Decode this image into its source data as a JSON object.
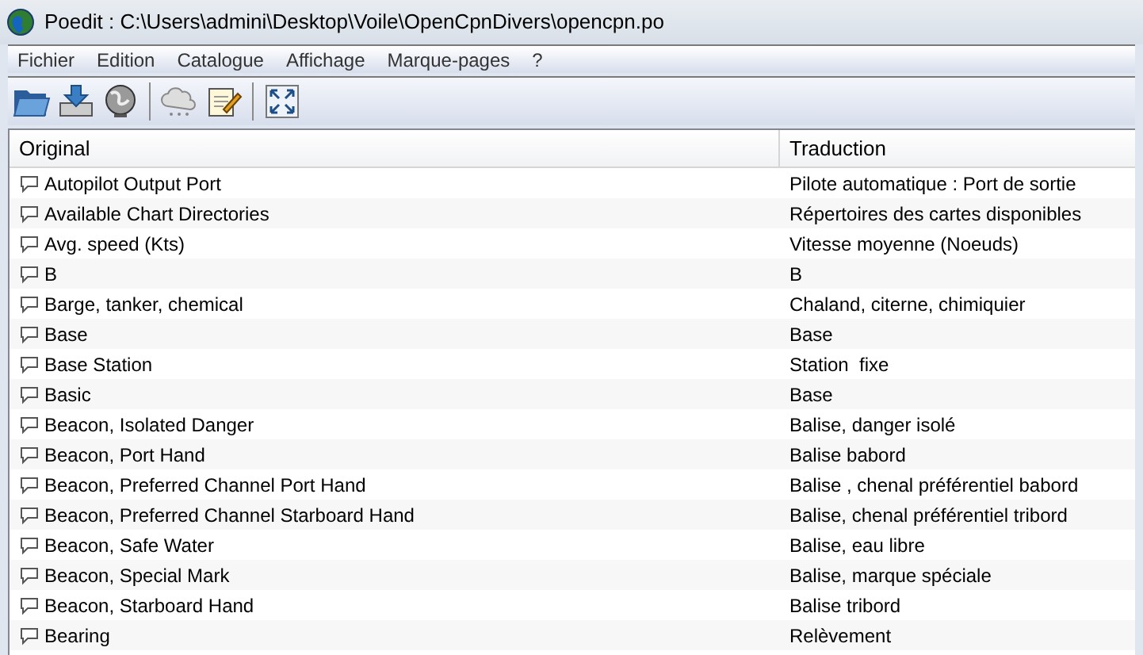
{
  "window": {
    "title": "Poedit : C:\\Users\\admini\\Desktop\\Voile\\OpenCpnDivers\\opencpn.po"
  },
  "menu": [
    "Fichier",
    "Edition",
    "Catalogue",
    "Affichage",
    "Marque-pages",
    "?"
  ],
  "table": {
    "columns": [
      "Original",
      "Traduction"
    ],
    "rows": [
      {
        "original": "Autopilot Output Port",
        "translation": "Pilote automatique : Port de sortie"
      },
      {
        "original": "Available Chart Directories",
        "translation": "Répertoires des cartes disponibles"
      },
      {
        "original": "Avg. speed (Kts)",
        "translation": "Vitesse moyenne (Noeuds)"
      },
      {
        "original": "B",
        "translation": "B"
      },
      {
        "original": "Barge, tanker, chemical",
        "translation": "Chaland, citerne, chimiquier"
      },
      {
        "original": "Base",
        "translation": "Base"
      },
      {
        "original": "Base Station",
        "translation": "Station  fixe"
      },
      {
        "original": "Basic",
        "translation": "Base"
      },
      {
        "original": "Beacon, Isolated Danger",
        "translation": "Balise, danger isolé"
      },
      {
        "original": "Beacon, Port Hand",
        "translation": "Balise babord"
      },
      {
        "original": "Beacon, Preferred Channel Port Hand",
        "translation": "Balise , chenal préférentiel babord"
      },
      {
        "original": "Beacon, Preferred Channel Starboard Hand",
        "translation": "Balise, chenal préférentiel tribord"
      },
      {
        "original": "Beacon, Safe Water",
        "translation": "Balise, eau libre"
      },
      {
        "original": "Beacon, Special Mark",
        "translation": "Balise, marque spéciale"
      },
      {
        "original": "Beacon, Starboard Hand",
        "translation": "Balise tribord"
      },
      {
        "original": "Bearing",
        "translation": "Relèvement"
      }
    ]
  }
}
